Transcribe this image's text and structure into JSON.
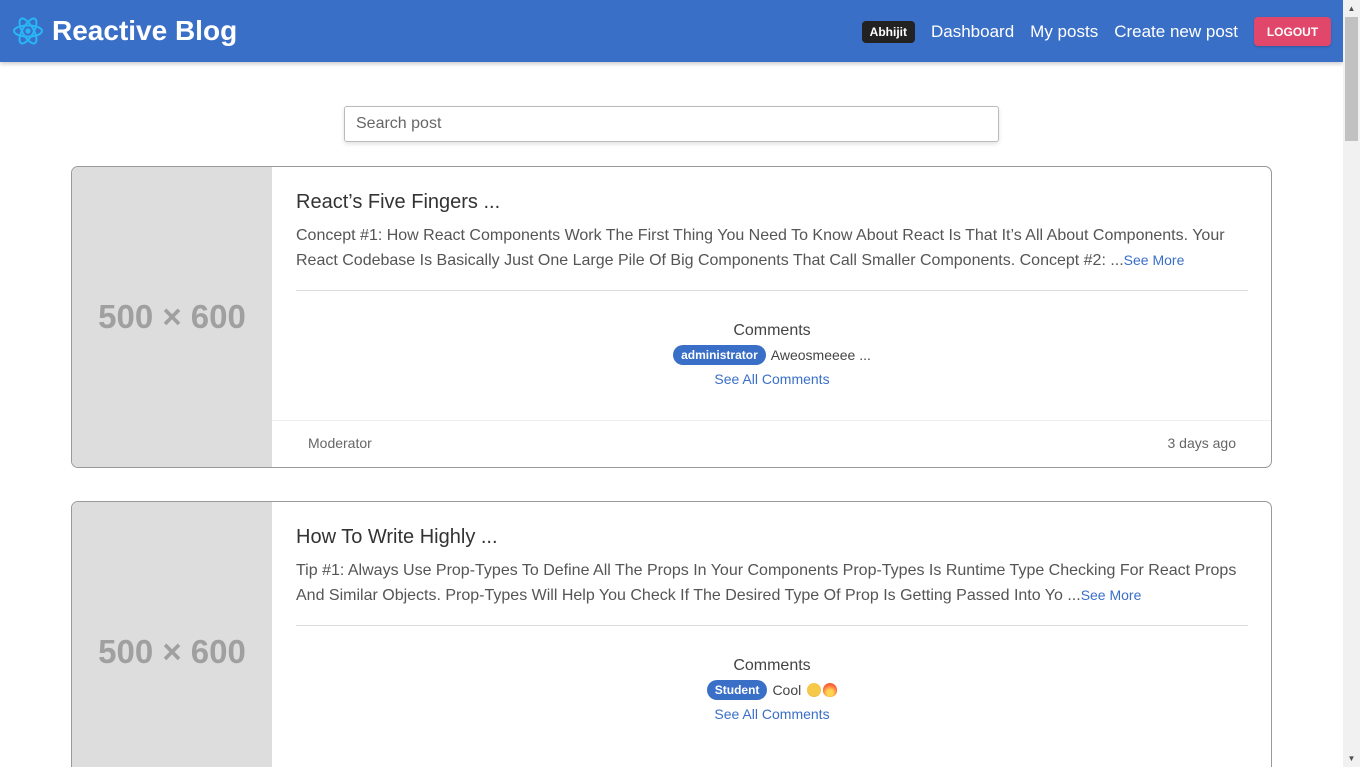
{
  "navbar": {
    "brand": "Reactive Blog",
    "user": "Abhijit",
    "links": [
      "Dashboard",
      "My posts",
      "Create new post"
    ],
    "logout_label": "LOGOUT",
    "logo_icon": "react-atom-icon",
    "colors": {
      "bar": "#3a6fc7",
      "logout": "#e0476a",
      "badge": "#222222"
    }
  },
  "search": {
    "placeholder": "Search post",
    "value": ""
  },
  "posts": [
    {
      "thumb_label": "500 × 600",
      "title": "React’s Five Fingers ...",
      "excerpt": "Concept #1: How React Components Work The First Thing You Need To Know About React Is That It’s All About Components. Your React Codebase Is Basically Just One Large Pile Of Big Components That Call Smaller Components. Concept #2: ...",
      "see_more": "See More",
      "comments_title": "Comments",
      "comment_role": "administrator",
      "comment_text": "Aweosmeeee ...",
      "see_all": "See All Comments",
      "author": "Moderator",
      "time": "3 days ago"
    },
    {
      "thumb_label": "500 × 600",
      "title": "How To Write Highly ...",
      "excerpt": "Tip #1: Always Use Prop-Types To Define All The Props In Your Components Prop-Types Is Runtime Type Checking For React Props And Similar Objects. Prop-Types Will Help You Check If The Desired Type Of Prop Is Getting Passed Into Yo ...",
      "see_more": "See More",
      "comments_title": "Comments",
      "comment_role": "Student",
      "comment_text": "Cool",
      "comment_emojis": [
        "star-struck-emoji",
        "fire-emoji"
      ],
      "see_all": "See All Comments"
    }
  ]
}
